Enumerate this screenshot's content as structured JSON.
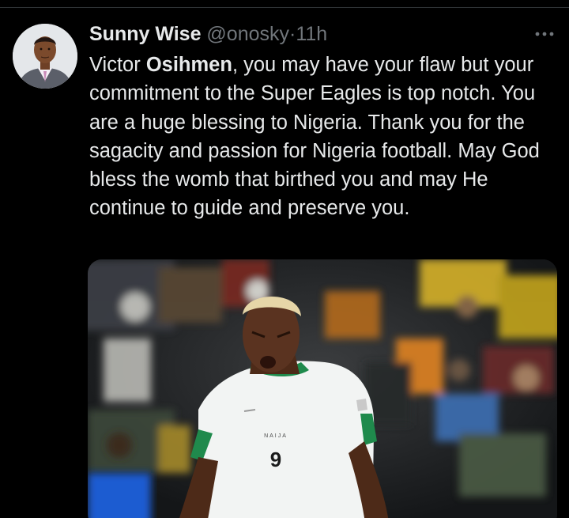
{
  "tweet": {
    "author_name": "Sunny Wise",
    "handle": "@onosky",
    "separator": "·",
    "time": "11h",
    "text_prefix": "Victor ",
    "text_bold": "Osihmen",
    "text_rest": ", you may have your flaw but your commitment to the Super Eagles is top notch. You are a huge blessing to Nigeria. Thank you for the sagacity and passion for Nigeria football. May God bless the womb that birthed you and may He continue to guide and preserve you."
  },
  "media": {
    "jersey_number": "9",
    "jersey_text": "NAIJA"
  },
  "icons": {
    "more": "more-horizontal-icon",
    "avatar": "avatar"
  },
  "colors": {
    "background": "#000000",
    "text": "#e7e9ea",
    "muted": "#71767b",
    "jersey_white": "#f2f4f3",
    "jersey_green": "#1f8a4c"
  }
}
